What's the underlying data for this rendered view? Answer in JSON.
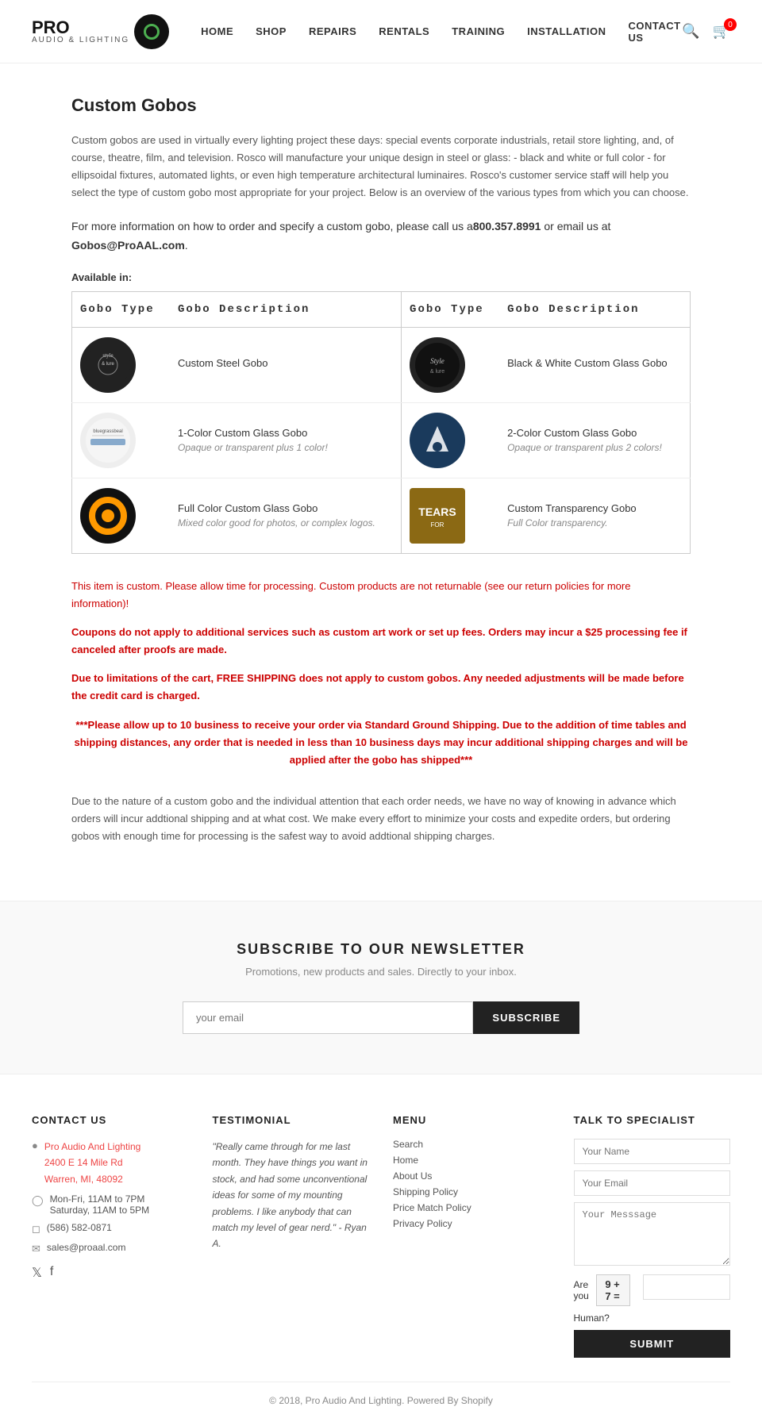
{
  "header": {
    "logo": {
      "brand": "PRO",
      "sub": "AUDIO & LIGHTING"
    },
    "nav": [
      {
        "label": "HOME",
        "href": "#"
      },
      {
        "label": "SHOP",
        "href": "#"
      },
      {
        "label": "REPAIRS",
        "href": "#"
      },
      {
        "label": "RENTALS",
        "href": "#"
      },
      {
        "label": "TRAINING",
        "href": "#"
      },
      {
        "label": "INSTALLATION",
        "href": "#"
      },
      {
        "label": "CONTACT US",
        "href": "#"
      }
    ],
    "cart_count": "0"
  },
  "page": {
    "title": "Custom Gobos",
    "intro": "Custom gobos are used in virtually every lighting project these days: special events corporate industrials, retail store lighting, and, of course, theatre, film, and television. Rosco will manufacture your unique design in steel or glass: - black and white or full color - for ellipsoidal fixtures, automated lights, or even high temperature architectural luminaires. Rosco's customer service staff will help you select the type of custom gobo most appropriate for your project. Below is an overview of the various types from which you can choose.",
    "contact_line": "For more information on how to order and specify a custom gobo, please call us a",
    "phone": "800.357.8991",
    "email_intro": " or email us at ",
    "email": "Gobos@ProAAL.com",
    "available_label": "Available in:",
    "table": {
      "headers": [
        "Gobo Type",
        "Gobo Description",
        "Gobo Type",
        "Gobo Description"
      ],
      "rows": [
        {
          "left_name": "Custom Steel Gobo",
          "left_sub": "",
          "right_name": "Black & White Custom Glass Gobo",
          "right_sub": ""
        },
        {
          "left_name": "1-Color Custom Glass Gobo",
          "left_sub": "Opaque or transparent plus 1 color!",
          "right_name": "2-Color Custom Glass Gobo",
          "right_sub": "Opaque or transparent plus 2 colors!"
        },
        {
          "left_name": "Full Color Custom Glass Gobo",
          "left_sub": "Mixed color good for photos, or complex logos.",
          "right_name": "Custom Transparency Gobo",
          "right_sub": "Full Color transparency."
        }
      ]
    },
    "notice1": "This item is custom. Please allow time for processing. Custom products are not returnable (see our return policies for more information)!",
    "notice2": "Coupons do not apply to additional services such as custom art work or set up fees. Orders may incur a $25 processing fee if canceled after proofs are made.",
    "notice3": "Due to limitations of the cart, FREE SHIPPING does not apply to custom gobos.  Any needed adjustments will be made before the credit card is charged.",
    "notice4": "***Please allow up to 10 business to receive your order via Standard Ground Shipping.  Due to the addition of time tables and shipping distances, any order that is needed in less than 10 business days may incur additional shipping charges and will be applied after the gobo has shipped***",
    "info_paragraph": "Due to the nature of a custom gobo and the individual attention that each order needs, we have no way of knowing in advance which orders will incur addtional shipping and at what cost. We make every effort to minimize your costs and expedite orders, but ordering gobos with enough time for processing is the safest way to avoid addtional shipping charges."
  },
  "newsletter": {
    "title": "SUBSCRIBE TO OUR NEWSLETTER",
    "subtitle": "Promotions, new products and sales. Directly to your inbox.",
    "input_placeholder": "your email",
    "button_label": "SUBSCRIBE"
  },
  "footer": {
    "contact": {
      "heading": "CONTACT US",
      "company": "Pro Audio And Lighting",
      "address1": "2400 E 14 Mile Rd",
      "address2": "Warren, MI, 48092",
      "hours1": "Mon-Fri, 11AM to 7PM",
      "hours2": "Saturday, 11AM to 5PM",
      "phone": "(586) 582-0871",
      "email": "sales@proaal.com"
    },
    "testimonial": {
      "heading": "TESTIMONIAL",
      "text": "\"Really came through for me last month. They have things you want in stock, and had some unconventional ideas for some of my mounting problems. I like anybody that can match my level of gear nerd.\" - Ryan A."
    },
    "menu": {
      "heading": "MENU",
      "items": [
        {
          "label": "Search",
          "href": "#"
        },
        {
          "label": "Home",
          "href": "#"
        },
        {
          "label": "About Us",
          "href": "#"
        },
        {
          "label": "Shipping Policy",
          "href": "#"
        },
        {
          "label": "Price Match Policy",
          "href": "#"
        },
        {
          "label": "Privacy Policy",
          "href": "#"
        }
      ]
    },
    "specialist": {
      "heading": "TALK TO SPECIALIST",
      "name_placeholder": "Your Name",
      "email_placeholder": "Your Email",
      "message_placeholder": "Your Messsage",
      "are_you": "Are you",
      "human": "Human?",
      "captcha_eq": "9 + 7 =",
      "submit_label": "SUBMIT"
    },
    "copyright": "© 2018, Pro Audio And Lighting. Powered By Shopify"
  }
}
